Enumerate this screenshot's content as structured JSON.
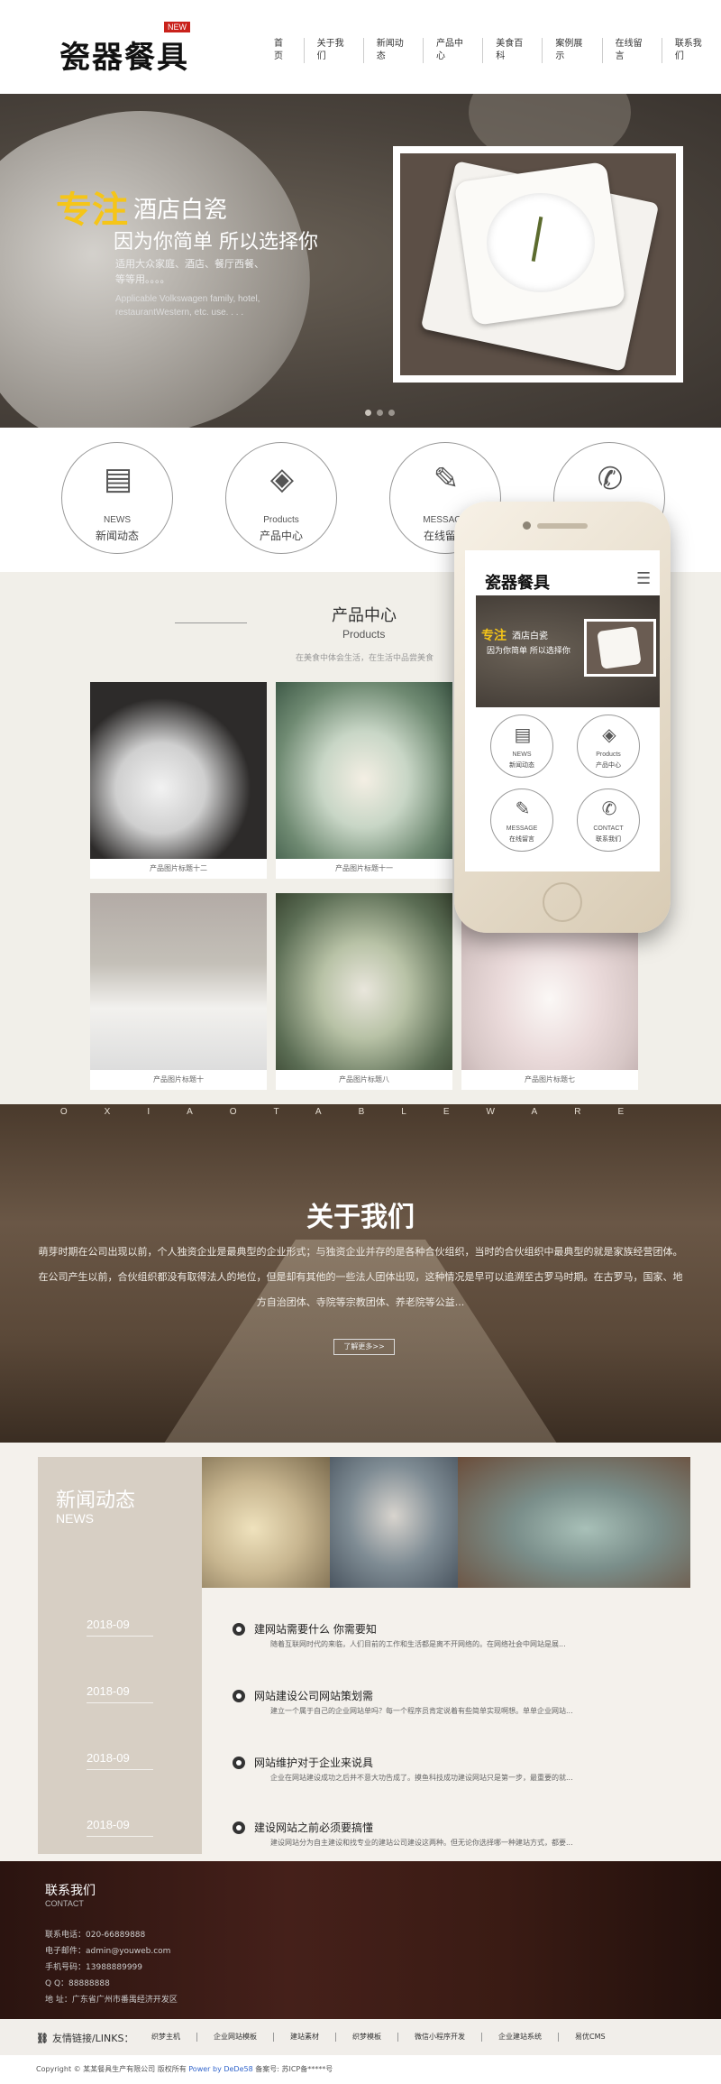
{
  "header": {
    "logo": "瓷器餐具",
    "badge": "NEW",
    "nav": [
      "首页",
      "关于我们",
      "新闻动态",
      "产品中心",
      "美食百科",
      "案例展示",
      "在线留言",
      "联系我们"
    ]
  },
  "banner": {
    "title_highlight": "专注",
    "title_rest": "酒店白瓷",
    "subtitle": "因为你简单  所以选择你",
    "desc_cn": "适用大众家庭、酒店、餐厅西餐、等等用。。。。",
    "desc_en": "Applicable Volkswagen family, hotel, restaurantWestern, etc. use. . . ."
  },
  "services": [
    {
      "icon": "document-icon",
      "glyph": "▤",
      "en": "NEWS",
      "cn": "新闻动态"
    },
    {
      "icon": "grid-icon",
      "glyph": "◈",
      "en": "Products",
      "cn": "产品中心"
    },
    {
      "icon": "pencil-icon",
      "glyph": "✎",
      "en": "MESSAGE",
      "cn": "在线留言"
    },
    {
      "icon": "phone-icon",
      "glyph": "✆",
      "en": "CONTACT",
      "cn": "联系我们"
    }
  ],
  "products": {
    "title": "产品中心",
    "title_en": "Products",
    "subtitle": "在美食中体会生活，在生活中品尝美食",
    "items": [
      {
        "label": "产品图片标题十二",
        "color": "#2d2b2a"
      },
      {
        "label": "产品图片标题十一",
        "color": "#6f8a72"
      },
      {
        "label": "产品图片标题十",
        "color": "#c4c0b8"
      },
      {
        "label": "产品图片标题九",
        "color": "#b6a9b4"
      },
      {
        "label": "产品图片标题八",
        "color": "#5b6d54"
      },
      {
        "label": "产品图片标题七",
        "color": "#d7c7c6"
      }
    ]
  },
  "phone": {
    "logo": "瓷器餐具",
    "menu_icon": "☰",
    "title_highlight": "专注",
    "title_rest": "酒店白瓷",
    "subtitle": "因为你简单 所以选择你"
  },
  "about": {
    "letters": "OXIAOTABLEWARE",
    "title": "关于我们",
    "text": "萌芽时期在公司出现以前，个人独资企业是最典型的企业形式；与独资企业并存的是各种合伙组织，当时的合伙组织中最典型的就是家族经营团体。在公司产生以前，合伙组织都没有取得法人的地位，但是却有其他的一些法人团体出现，这种情况是早可以追溯至古罗马时期。在古罗马，国家、地方自治团体、寺院等宗教团体、养老院等公益...",
    "button": "了解更多>>"
  },
  "news": {
    "title": "新闻动态",
    "title_en": "NEWS",
    "dates": [
      "2018-09",
      "2018-09",
      "2018-09",
      "2018-09"
    ],
    "images": [
      {
        "color": "#c8b690"
      },
      {
        "color": "#7f8c94"
      },
      {
        "color": "#7a8e8a"
      }
    ],
    "items": [
      {
        "title": "建网站需要什么 你需要知",
        "summary": "随着互联网时代的来临，人们目前的工作和生活都是离不开网络的。在网络社会中网站是展..."
      },
      {
        "title": "网站建设公司网站策划需",
        "summary": "建立一个属于自己的企业网站单吗？每一个程序员肯定说着有些简单实现啊想。单单企业网站..."
      },
      {
        "title": "网站维护对于企业来说具",
        "summary": "企业在网站建设成功之后并不意大功告成了。摸鱼科技成功建设网站只是第一步，最重要的就..."
      },
      {
        "title": "建设网站之前必须要搞懂",
        "summary": "建设网站分为自主建设和找专业的建站公司建设这两种。但无论你选择哪一种建站方式，都要..."
      }
    ]
  },
  "contact": {
    "title": "联系我们",
    "title_en": "CONTACT",
    "rows": [
      {
        "label": "联系电话：",
        "value": "020-66889888"
      },
      {
        "label": "电子邮件：",
        "value": "admin@youweb.com"
      },
      {
        "label": "手机号码：",
        "value": "13988889999"
      },
      {
        "label": "Q  Q：",
        "value": "88888888"
      },
      {
        "label": "地  址：",
        "value": "广东省广州市番禺经济开发区"
      }
    ]
  },
  "links": {
    "icon": "link-icon",
    "label": "友情链接/LINKS：",
    "items": [
      "织梦主机",
      "企业网站模板",
      "建站素材",
      "织梦模板",
      "微信小程序开发",
      "企业建站系统",
      "易优CMS"
    ]
  },
  "footer": {
    "copyright": "Copyright © 某某餐具生产有限公司 版权所有 ",
    "powered": "Power by DeDe58",
    "icp": "  备案号: 苏ICP备*****号"
  }
}
